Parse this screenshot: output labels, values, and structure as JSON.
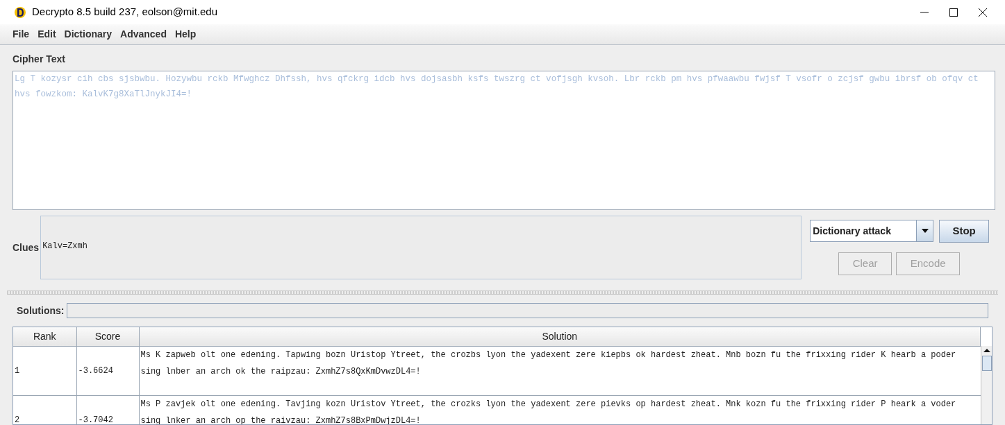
{
  "window": {
    "title": "Decrypto 8.5 build 237, eolson@mit.edu"
  },
  "menu": [
    {
      "label": "File"
    },
    {
      "label": "Edit"
    },
    {
      "label": "Dictionary"
    },
    {
      "label": "Advanced"
    },
    {
      "label": "Help"
    }
  ],
  "cipher_text": {
    "label": "Cipher Text",
    "value": "Lg T kozysr cih cbs sjsbwbu. Hozywbu rckb Mfwghcz Dhfssh, hvs qfckrg idcb hvs dojsasbh ksfs twszrg ct vofjsgh kvsoh. Lbr rckb pm hvs pfwaawbu fwjsf T vsofr o zcjsf gwbu ibrsf ob ofqv ct hvs fowzkom: KalvK7g8XaTlJnykJI4=!"
  },
  "clues": {
    "label": "Clues",
    "value": "Kalv=Zxmh"
  },
  "attack_select": {
    "value": "Dictionary attack"
  },
  "buttons": [
    {
      "label": "Stop",
      "disabled": false
    },
    {
      "label": "Clear",
      "disabled": true
    },
    {
      "label": "Encode",
      "disabled": true
    }
  ],
  "solutions": {
    "label": "Solutions:"
  },
  "table": {
    "columns": [
      "Rank",
      "Score",
      "Solution"
    ],
    "rows": [
      {
        "rank": "1",
        "score": "-3.6624",
        "solution": "Ms K zapweb olt one edening. Tapwing bozn Uristop Ytreet, the crozbs lyon the yadexent zere kiepbs ok hardest zheat. Mnb bozn fu the frixxing rider K hearb a poder sing lnber an arch ok the raipzau: ZxmhZ7s8QxKmDvwzDL4=!"
      },
      {
        "rank": "2",
        "score": "-3.7042",
        "solution": "Ms P zavjek olt one edening. Tavjing kozn Uristov Ytreet, the crozks lyon the yadexent zere pievks op hardest zheat. Mnk kozn fu the frixxing rider P heark a voder sing lnker an arch op the raivzau: ZxmhZ7s8BxPmDwjzDL4=!"
      }
    ]
  }
}
